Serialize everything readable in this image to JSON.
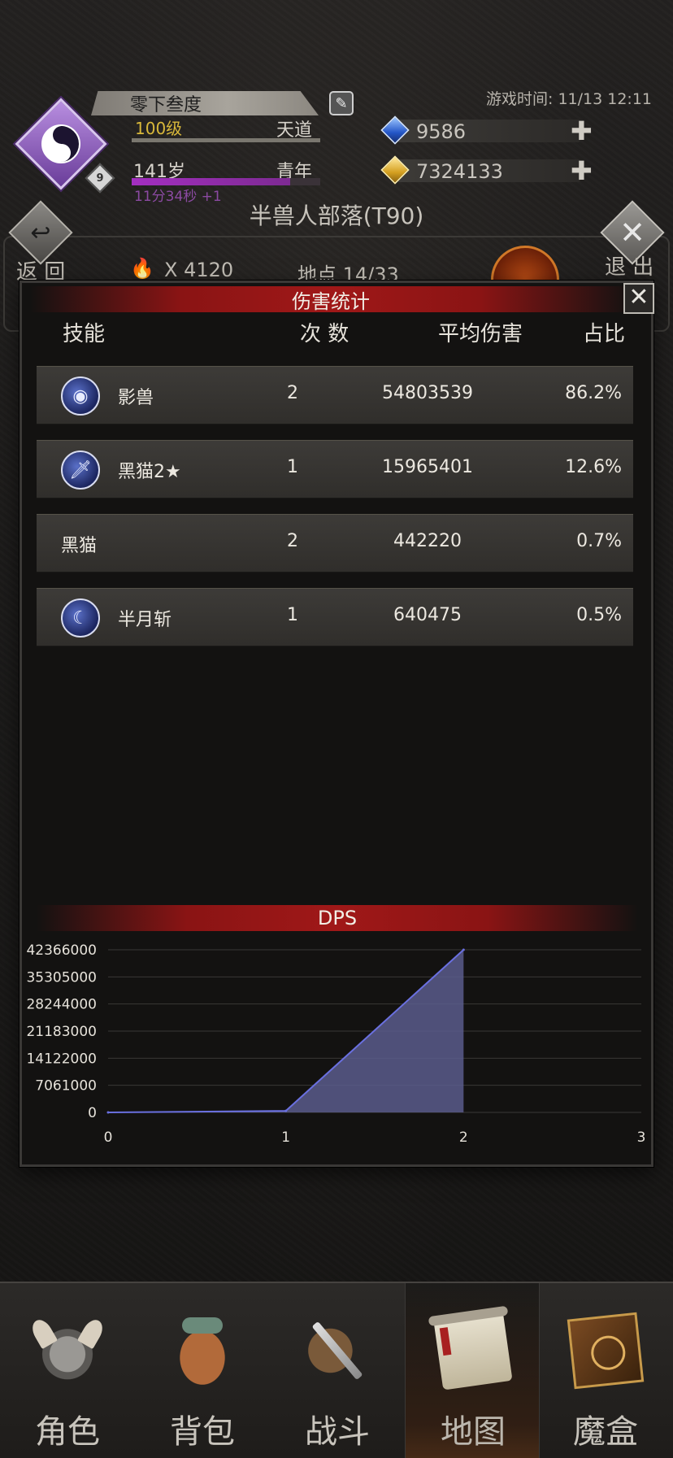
{
  "header": {
    "player_name": "零下叁度",
    "avatar_level_badge": "9",
    "level": "100级",
    "realm": "天道",
    "level_progress": 1.0,
    "age": "141岁",
    "life_stage": "青年",
    "age_progress": 0.84,
    "timer": "11分34秒 +1",
    "game_time": "游戏时间: 11/13 12:11",
    "gems": "9586",
    "gold": "7324133"
  },
  "location": {
    "title": "半兽人部落(T90)",
    "back_label": "返 回",
    "exit_label": "退 出",
    "torch_count": "X 4120",
    "site_progress": "地点 14/33"
  },
  "damage_panel": {
    "title": "伤害统计",
    "close_glyph": "✕",
    "columns": {
      "skill": "技能",
      "count": "次 数",
      "avg_damage": "平均伤害",
      "share": "占比"
    },
    "rows": [
      {
        "name": "影兽",
        "count": "2",
        "avg": "54803539",
        "pct": "86.2%",
        "icon": "shadow-beast-icon"
      },
      {
        "name": "黑猫2★",
        "count": "1",
        "avg": "15965401",
        "pct": "12.6%",
        "icon": "sword-icon"
      },
      {
        "name": "黑猫",
        "count": "2",
        "avg": "442220",
        "pct": "0.7%",
        "icon": ""
      },
      {
        "name": "半月斩",
        "count": "1",
        "avg": "640475",
        "pct": "0.5%",
        "icon": "crescent-moon-icon"
      }
    ]
  },
  "chart_data": {
    "type": "area",
    "title": "DPS",
    "x": [
      0,
      1,
      2
    ],
    "values": [
      0,
      400000,
      42366000
    ],
    "xlim": [
      0,
      3
    ],
    "ylim": [
      0,
      42366000
    ],
    "y_ticks": [
      "0",
      "7061000",
      "14122000",
      "21183000",
      "28244000",
      "35305000",
      "42366000"
    ],
    "x_ticks": [
      "0",
      "1",
      "2",
      "3"
    ],
    "grid": true,
    "line_color": "#6a70e0",
    "fill_color": "#5a5c8c"
  },
  "bottom_nav": {
    "items": [
      {
        "label": "角色",
        "icon": "helmet-icon"
      },
      {
        "label": "背包",
        "icon": "backpack-icon"
      },
      {
        "label": "战斗",
        "icon": "sword-shield-icon"
      },
      {
        "label": "地图",
        "icon": "scroll-map-icon",
        "active": true
      },
      {
        "label": "魔盒",
        "icon": "magic-box-icon"
      }
    ]
  }
}
